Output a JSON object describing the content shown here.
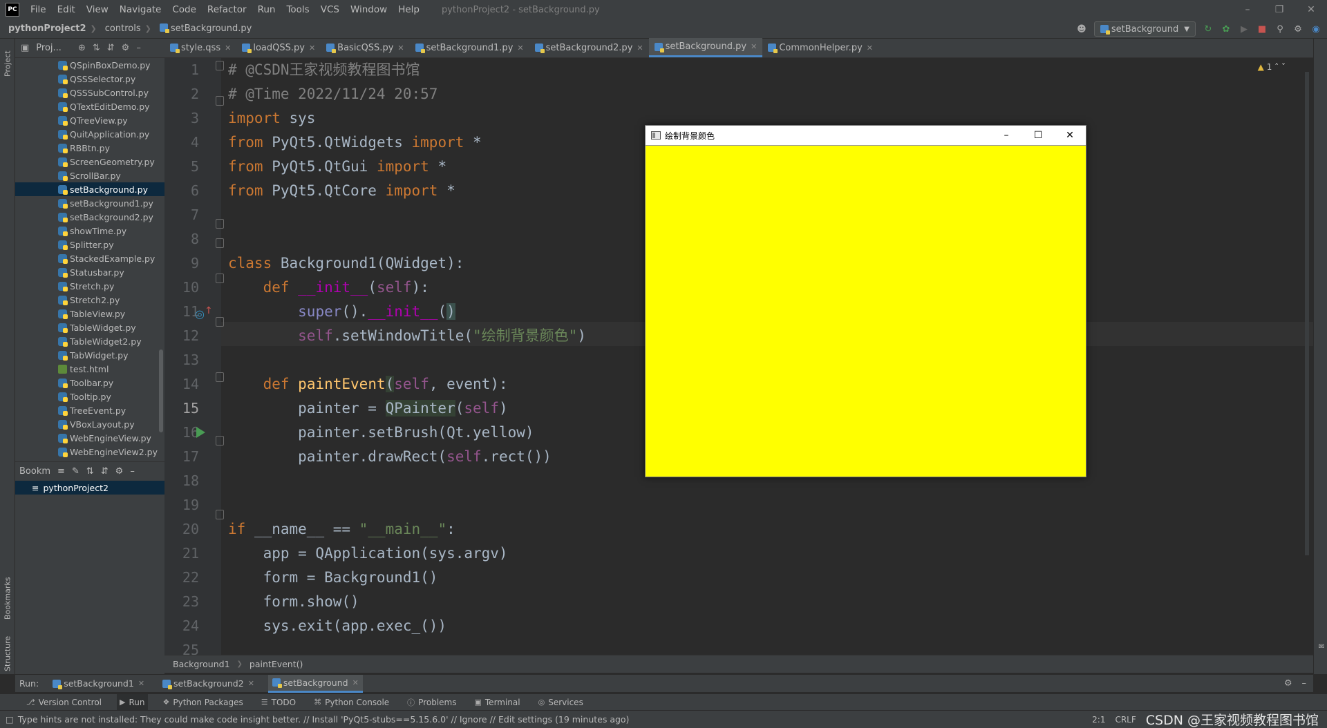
{
  "menubar": {
    "logo_text": "PC",
    "items": [
      "File",
      "Edit",
      "View",
      "Navigate",
      "Code",
      "Refactor",
      "Run",
      "Tools",
      "VCS",
      "Window",
      "Help"
    ],
    "window_title": "pythonProject2 - setBackground.py"
  },
  "navbar": {
    "project": "pythonProject2",
    "folder": "controls",
    "file": "setBackground.py",
    "run_config": "setBackground"
  },
  "left_strip": {
    "project_tab": "Project",
    "bookmarks_tab": "Bookmarks",
    "structure_tab": "Structure"
  },
  "project_panel": {
    "header_label": "Proj...",
    "files": [
      "QSpinBoxDemo.py",
      "QSSSelector.py",
      "QSSSubControl.py",
      "QTextEditDemo.py",
      "QTreeView.py",
      "QuitApplication.py",
      "RBBtn.py",
      "ScreenGeometry.py",
      "ScrollBar.py",
      "setBackground.py",
      "setBackground1.py",
      "setBackground2.py",
      "showTime.py",
      "Splitter.py",
      "StackedExample.py",
      "Statusbar.py",
      "Stretch.py",
      "Stretch2.py",
      "TableView.py",
      "TableWidget.py",
      "TableWidget2.py",
      "TabWidget.py",
      "test.html",
      "Toolbar.py",
      "Tooltip.py",
      "TreeEvent.py",
      "VBoxLayout.py",
      "WebEngineView.py",
      "WebEngineView2.py"
    ],
    "selected_file": "setBackground.py",
    "bookmarks_label": "Bookm",
    "bookmark_item": "pythonProject2"
  },
  "editor_tabs": [
    {
      "label": "style.qss",
      "active": false
    },
    {
      "label": "loadQSS.py",
      "active": false
    },
    {
      "label": "BasicQSS.py",
      "active": false
    },
    {
      "label": "setBackground1.py",
      "active": false
    },
    {
      "label": "setBackground2.py",
      "active": false
    },
    {
      "label": "setBackground.py",
      "active": true
    },
    {
      "label": "CommonHelper.py",
      "active": false
    }
  ],
  "editor": {
    "warning_count": "1",
    "current_line": 15,
    "line_numbers": [
      "1",
      "2",
      "3",
      "4",
      "5",
      "6",
      "7",
      "8",
      "9",
      "10",
      "11",
      "12",
      "13",
      "14",
      "15",
      "16",
      "17",
      "18",
      "19",
      "20",
      "21",
      "22",
      "23",
      "24",
      "25"
    ]
  },
  "breadcrumb": {
    "class_name": "Background1",
    "method_name": "paintEvent()"
  },
  "run_bar": {
    "label": "Run:",
    "tabs": [
      {
        "label": "setBackground1",
        "active": false
      },
      {
        "label": "setBackground2",
        "active": false
      },
      {
        "label": "setBackground",
        "active": true
      }
    ]
  },
  "tool_bar": {
    "items": [
      "Version Control",
      "Run",
      "Python Packages",
      "TODO",
      "Python Console",
      "Problems",
      "Terminal",
      "Services"
    ],
    "active": "Run"
  },
  "status_bar": {
    "message": "Type hints are not installed: They could make code insight better. // Install 'PyQt5-stubs==5.15.6.0' // Ignore // Edit settings (19 minutes ago)",
    "position": "2:1",
    "line_sep": "CRLF",
    "watermark": "CSDN @王家视频教程图书馆"
  },
  "app_window": {
    "title": "绘制背景颜色",
    "canvas_color": "#ffff00"
  },
  "colors": {
    "ide_background": "#2b2b2b",
    "panel_background": "#3c3f41",
    "keyword": "#cc7832",
    "string": "#6a8759",
    "comment": "#808080",
    "selection": "#0d293e"
  }
}
